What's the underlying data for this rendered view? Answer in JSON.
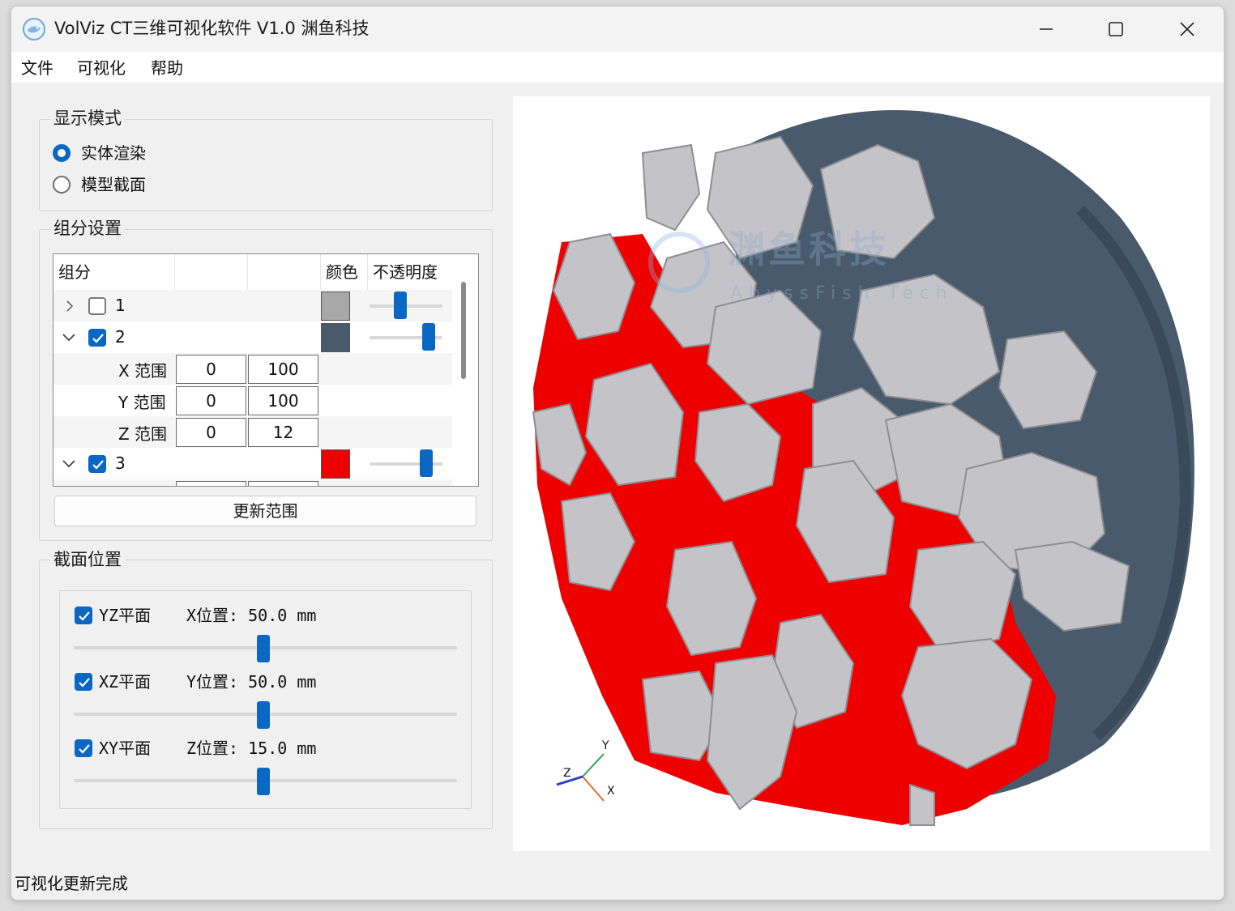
{
  "window": {
    "title": "VolViz CT三维可视化软件 V1.0 渊鱼科技"
  },
  "menu": [
    "文件",
    "可视化",
    "帮助"
  ],
  "display_mode": {
    "title": "显示模式",
    "options": [
      {
        "label": "实体渲染",
        "selected": true
      },
      {
        "label": "模型截面",
        "selected": false
      }
    ]
  },
  "components": {
    "title": "组分设置",
    "headers": {
      "group": "组分",
      "color": "颜色",
      "opacity": "不透明度"
    },
    "rows": [
      {
        "id": "1",
        "checked": false,
        "expanded": false,
        "color": "#a8a8a8",
        "opacity": 0.45
      },
      {
        "id": "2",
        "checked": true,
        "expanded": true,
        "color": "#485a6c",
        "opacity": 0.85,
        "ranges": [
          {
            "label": "X 范围",
            "min": "0",
            "max": "100"
          },
          {
            "label": "Y 范围",
            "min": "0",
            "max": "100"
          },
          {
            "label": "Z 范围",
            "min": "0",
            "max": "12"
          }
        ]
      },
      {
        "id": "3",
        "checked": true,
        "expanded": true,
        "color": "#ee0000",
        "opacity": 0.8
      }
    ],
    "update_button": "更新范围"
  },
  "section_position": {
    "title": "截面位置",
    "planes": [
      {
        "label": "YZ平面",
        "checked": true,
        "readout": "X位置: 50.0 mm",
        "value": 0.5
      },
      {
        "label": "XZ平面",
        "checked": true,
        "readout": "Y位置: 50.0 mm",
        "value": 0.5
      },
      {
        "label": "XY平面",
        "checked": true,
        "readout": "Z位置: 15.0 mm",
        "value": 0.5
      }
    ]
  },
  "viewport": {
    "watermark": "渊鱼科技",
    "watermark_sub": "AbyssFish Tech",
    "axes": [
      "X",
      "Y",
      "Z"
    ],
    "colors": {
      "matrix": "#485a6c",
      "particles": "#c4c4c8",
      "binder": "#ee0000",
      "accent": "#0a67c3"
    }
  },
  "status": "可视化更新完成"
}
